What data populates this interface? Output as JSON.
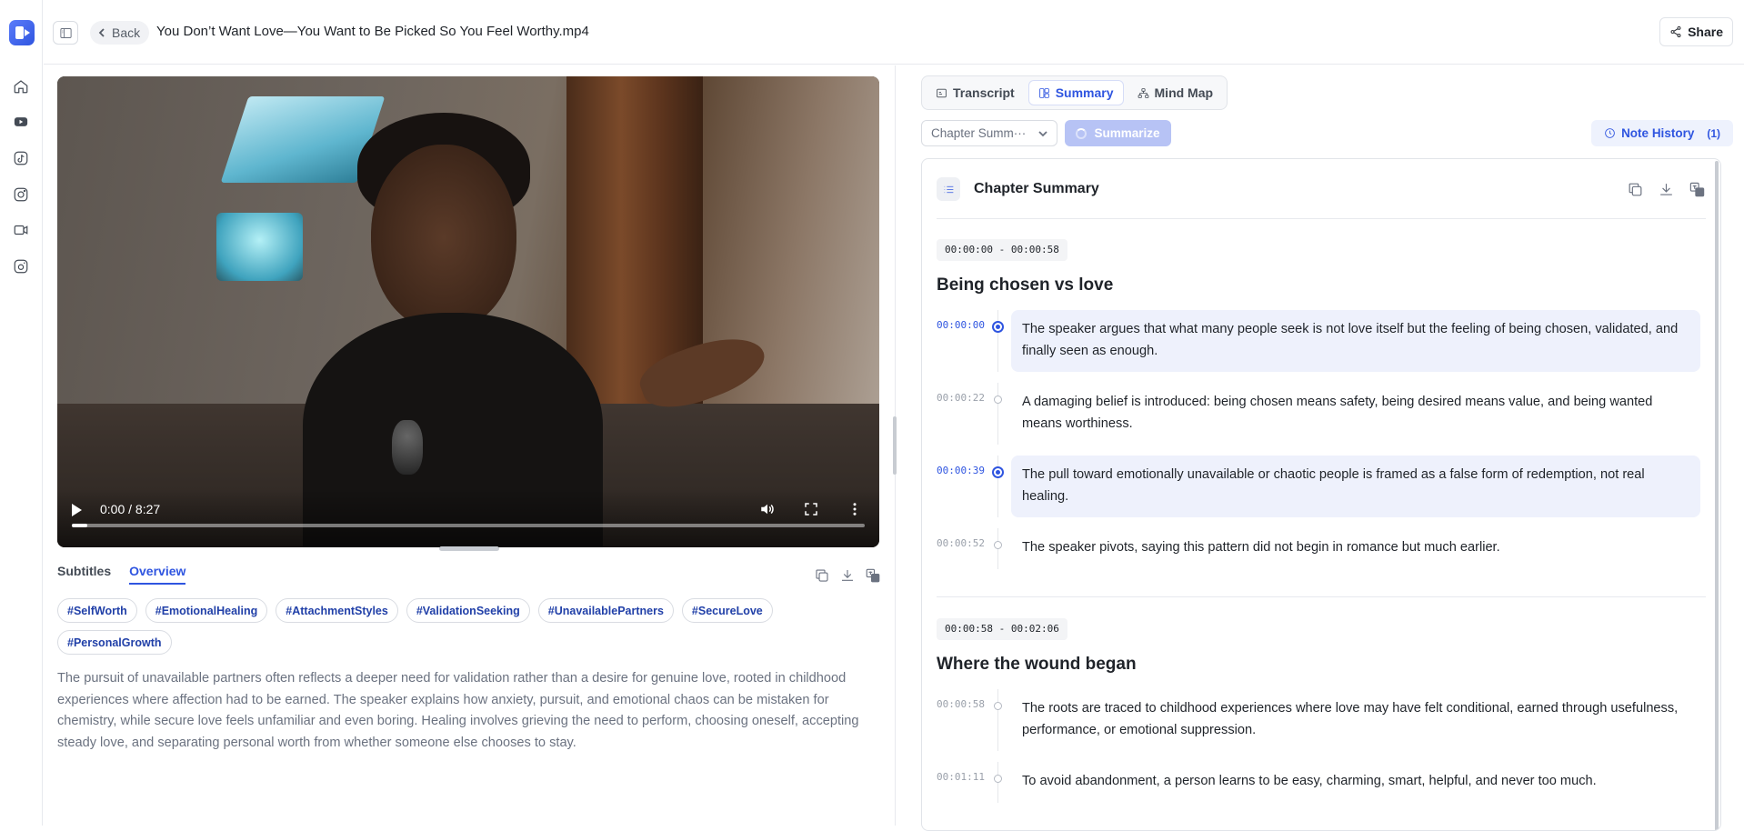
{
  "header": {
    "back_label": "Back",
    "file_title": "You Don’t Want Love—You Want to Be Picked So You Feel Worthy.mp4",
    "share_label": "Share"
  },
  "rail": {
    "icons": [
      "app-logo",
      "home-icon",
      "youtube-icon",
      "tiktok-icon",
      "instagram-icon",
      "video-icon",
      "camera-icon"
    ]
  },
  "video": {
    "time": "0:00 / 8:27",
    "progress_fraction": 0.02
  },
  "left_tabs": [
    "Subtitles",
    "Overview"
  ],
  "tags": [
    "#SelfWorth",
    "#EmotionalHealing",
    "#AttachmentStyles",
    "#ValidationSeeking",
    "#UnavailablePartners",
    "#SecureLove",
    "#PersonalGrowth"
  ],
  "overview": "The pursuit of unavailable partners often reflects a deeper need for validation rather than a desire for genuine love, rooted in childhood experiences where affection had to be earned. The speaker explains how anxiety, pursuit, and emotional chaos can be mistaken for chemistry, while secure love feels unfamiliar and even boring. Healing involves grieving the need to perform, choosing oneself, accepting steady love, and separating personal worth from whether someone else chooses to stay.",
  "right": {
    "tabs": [
      "Transcript",
      "Summary",
      "Mind Map"
    ],
    "active_tab": "Summary",
    "mode_select": "Chapter Summ···",
    "summarize_label": "Summarize",
    "note_history_label": "Note History",
    "note_history_count": "(1)",
    "card_title": "Chapter Summary"
  },
  "chapters": [
    {
      "range": "00:00:00 - 00:00:58",
      "title": "Being chosen vs love",
      "entries": [
        {
          "ts": "00:00:00",
          "text": "The speaker argues that what many people seek is not love itself but the feeling of being chosen, validated, and finally seen as enough."
        },
        {
          "ts": "00:00:22",
          "text": "A damaging belief is introduced: being chosen means safety, being desired means value, and being wanted means worthiness."
        },
        {
          "ts": "00:00:39",
          "text": "The pull toward emotionally unavailable or chaotic people is framed as a false form of redemption, not real healing."
        },
        {
          "ts": "00:00:52",
          "text": "The speaker pivots, saying this pattern did not begin in romance but much earlier."
        }
      ]
    },
    {
      "range": "00:00:58 - 00:02:06",
      "title": "Where the wound began",
      "entries": [
        {
          "ts": "00:00:58",
          "text": "The roots are traced to childhood experiences where love may have felt conditional, earned through usefulness, performance, or emotional suppression."
        },
        {
          "ts": "00:01:11",
          "text": "To avoid abandonment, a person learns to be easy, charming, smart, helpful, and never too much."
        }
      ]
    }
  ],
  "colors": {
    "accent": "#2f55e0",
    "highlight": "#eef1fc",
    "tag_text": "#2140a8",
    "muted_text": "#6b7280"
  }
}
